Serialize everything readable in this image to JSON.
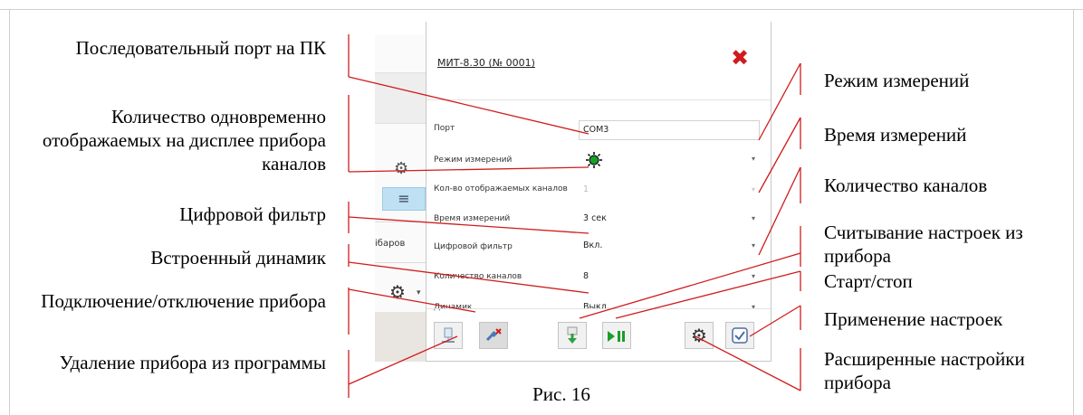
{
  "callouts_left": [
    {
      "id": "serial-port",
      "text": "Последовательный порт на ПК"
    },
    {
      "id": "display-channels",
      "text": "Количество одновременно отображаемых на дисплее прибора каналов"
    },
    {
      "id": "digital-filter",
      "text": "Цифровой фильтр"
    },
    {
      "id": "speaker",
      "text": "Встроенный динамик"
    },
    {
      "id": "connect-disconnect",
      "text": "Подключение/отключение прибора"
    },
    {
      "id": "remove-device",
      "text": "Удаление прибора из программы"
    }
  ],
  "callouts_right": [
    {
      "id": "measure-mode",
      "text": "Режим измерений"
    },
    {
      "id": "measure-time",
      "text": "Время измерений"
    },
    {
      "id": "channel-count",
      "text": "Количество каналов"
    },
    {
      "id": "read-settings",
      "text": "Считывание настроек из прибора"
    },
    {
      "id": "start-stop",
      "text": "Старт/стоп"
    },
    {
      "id": "apply-settings",
      "text": "Применение настроек"
    },
    {
      "id": "advanced-settings",
      "text": "Расширенные настройки прибора"
    }
  ],
  "caption": "Рис. 16",
  "background_app": {
    "partial_text": "ібаров"
  },
  "dialog": {
    "device_title": "МИТ-8.30 (№ 0001)",
    "fields": [
      {
        "label": "Порт",
        "value": "COM3",
        "type": "text"
      },
      {
        "label": "Режим измерений",
        "value": "",
        "type": "select-icon"
      },
      {
        "label": "Кол-во отображаемых каналов",
        "value": "1",
        "type": "select-disabled"
      },
      {
        "label": "Время измерений",
        "value": "3 сек",
        "type": "select"
      },
      {
        "label": "Цифровой фильтр",
        "value": "Вкл.",
        "type": "select"
      },
      {
        "label": "Количество каналов",
        "value": "8",
        "type": "select"
      },
      {
        "label": "Динамик",
        "value": "Выкл.",
        "type": "select"
      }
    ]
  },
  "colors": {
    "close": "#d01c1c",
    "callout_line": "#d01c1c",
    "play_green": "#1a9e2a",
    "download_green": "#2f9e44"
  }
}
